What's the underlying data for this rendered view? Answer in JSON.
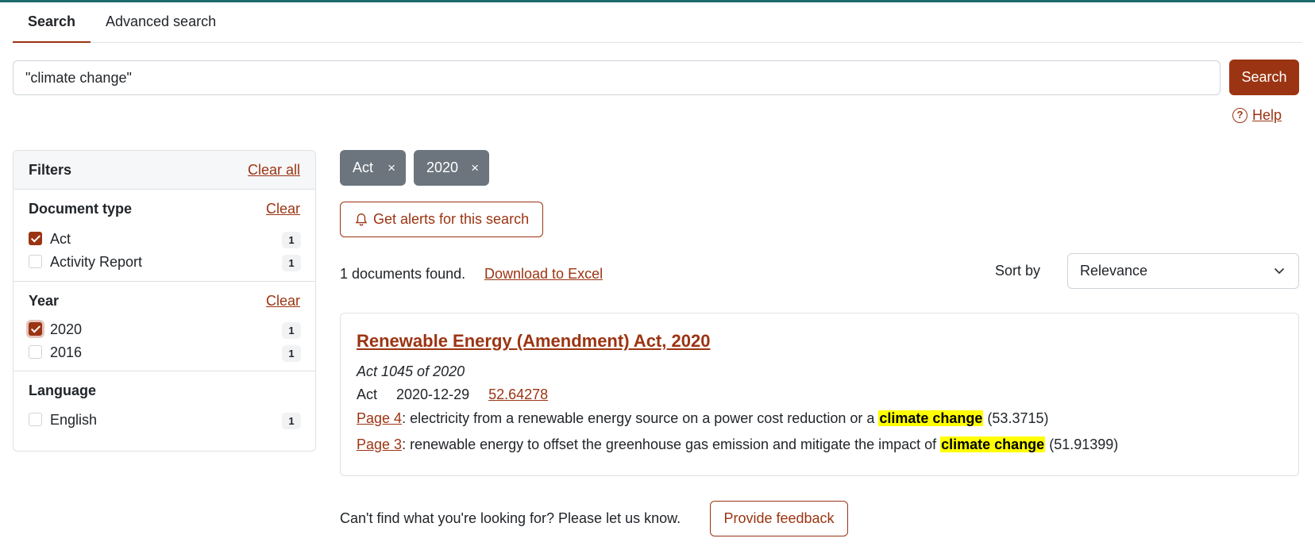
{
  "tabs": {
    "search": "Search",
    "advanced": "Advanced search"
  },
  "search": {
    "query": "\"climate change\"",
    "button": "Search",
    "help": "Help"
  },
  "filters": {
    "title": "Filters",
    "clear_all": "Clear all",
    "document_type": {
      "title": "Document type",
      "clear": "Clear",
      "options": [
        {
          "label": "Act",
          "count": "1",
          "checked": true
        },
        {
          "label": "Activity Report",
          "count": "1",
          "checked": false
        }
      ]
    },
    "year": {
      "title": "Year",
      "clear": "Clear",
      "options": [
        {
          "label": "2020",
          "count": "1",
          "checked": true
        },
        {
          "label": "2016",
          "count": "1",
          "checked": false
        }
      ]
    },
    "language": {
      "title": "Language",
      "options": [
        {
          "label": "English",
          "count": "1",
          "checked": false
        }
      ]
    }
  },
  "chips": [
    {
      "label": "Act",
      "remove": "×"
    },
    {
      "label": "2020",
      "remove": "×"
    }
  ],
  "alerts_button": "Get alerts for this search",
  "results": {
    "found": "1 documents found.",
    "download": "Download to Excel",
    "sort_label": "Sort by",
    "sort_value": "Relevance",
    "items": [
      {
        "title": "Renewable Energy (Amendment) Act, 2020",
        "subtitle": "Act 1045 of 2020",
        "type": "Act",
        "date": "2020-12-29",
        "score": "52.64278",
        "snippets": [
          {
            "page": "Page 4",
            "text": ": electricity from a renewable energy source on a power cost reduction or a ",
            "highlight": "climate change",
            "score": " (53.3715)"
          },
          {
            "page": "Page 3",
            "text": ": renewable energy to offset the greenhouse gas emission and mitigate the impact of ",
            "highlight": "climate change",
            "score": " (51.91399)"
          }
        ]
      }
    ]
  },
  "footer": {
    "prompt": "Can't find what you're looking for? Please let us know.",
    "feedback": "Provide feedback"
  },
  "colors": {
    "accent": "#9b3412",
    "chip": "#6c757d",
    "highlight": "#ffff00",
    "topbar": "#1e6b6b"
  },
  "icons": {
    "help": "question-circle-icon",
    "alerts": "bell-icon",
    "sort": "chevron-down-icon",
    "chip_remove": "close-icon"
  }
}
